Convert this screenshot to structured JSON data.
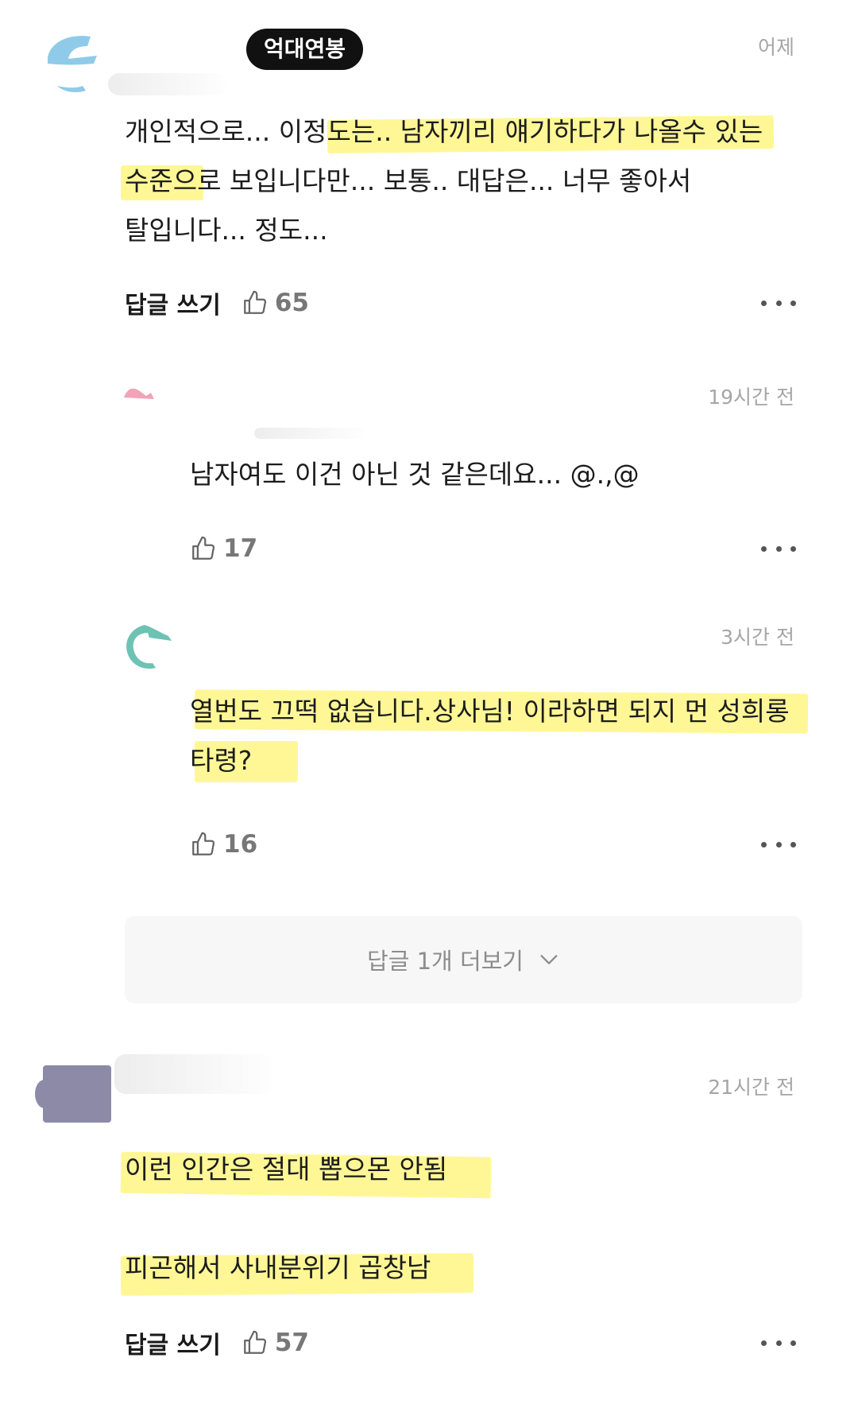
{
  "comments": [
    {
      "badge": "억대연봉",
      "time": "어제",
      "lines": [
        "개인적으로... 이정도는.. 남자끼리 얘기하다가 나올수 있는",
        "수준으로 보입니다만... 보통..  대답은...  너무 좋아서",
        "탈입니다... 정도..."
      ],
      "reply_label": "답글 쓰기",
      "likes": "65"
    },
    {
      "time": "19시간 전",
      "lines": [
        "남자여도 이건 아닌 것 같은데요... @.,@"
      ],
      "likes": "17"
    },
    {
      "time": "3시간 전",
      "lines": [
        "열번도 끄떡 없습니다.상사님! 이라하면 되지 먼 성희롱",
        "타령?"
      ],
      "likes": "16"
    },
    {
      "time": "21시간 전",
      "lines": [
        "이런 인간은 절대 뽑으몬 안됨",
        "피곤해서 사내분위기 곱창남"
      ],
      "reply_label": "답글 쓰기",
      "likes": "57"
    }
  ],
  "more_replies": {
    "label": "답글 1개 더보기",
    "icon": "chevron-down-icon"
  },
  "icons": {
    "like": "thumbs-up-icon",
    "more": "more-horizontal-icon"
  },
  "colors": {
    "highlight": "#FFF46E",
    "badge_bg": "#111111",
    "meta_text": "#A6A6A6",
    "like_count": "#777777"
  }
}
